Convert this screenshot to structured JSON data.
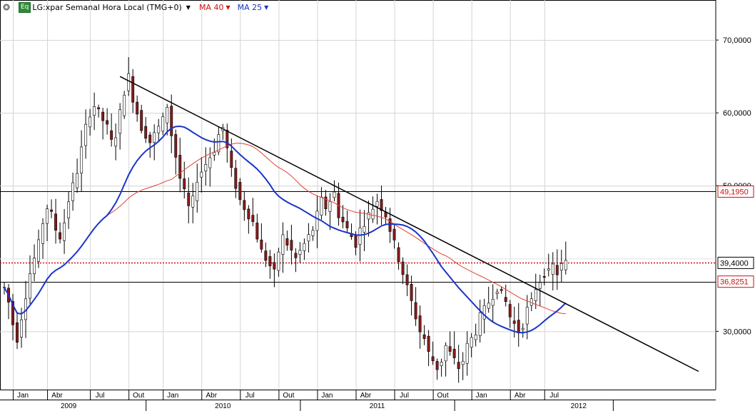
{
  "header": {
    "badge": "Eq",
    "instrument": "LG:xpar Semanal Hora Local (TMG+0)",
    "ma40_label": "MA 40",
    "ma25_label": "MA 25"
  },
  "colors": {
    "ma40": "#e0403a",
    "ma25": "#1a35c8",
    "up_candle": "#ffffff",
    "down_candle": "#8b1a1a",
    "label_red": "#cc1111"
  },
  "chart_data": {
    "type": "candlestick",
    "price_axis": {
      "ticks": [
        "70,0000",
        "60,0000",
        "50,0000",
        "30,0000"
      ],
      "tick_values": [
        70,
        60,
        50,
        30
      ],
      "range": [
        22.0,
        75.5
      ]
    },
    "price_labels": [
      {
        "text": "49,1950",
        "value": 49.195,
        "style": "boxed-red"
      },
      {
        "text": "39,4000",
        "value": 39.4,
        "style": "boxed-black"
      },
      {
        "text": "36,8251",
        "value": 36.8251,
        "style": "boxed-red"
      }
    ],
    "horizontal_levels": [
      {
        "value": 49.195,
        "style": "solid"
      },
      {
        "value": 39.4,
        "style": "dotted-red"
      },
      {
        "value": 36.8251,
        "style": "solid"
      }
    ],
    "trendline": {
      "start": {
        "week": 28,
        "value": 65.0
      },
      "end": {
        "week": 163,
        "value": 24.5
      }
    },
    "x_axis": {
      "week_range": [
        0,
        167
      ],
      "month_labels": [
        "Jan",
        "Abr",
        "Jul",
        "Out",
        "Jan",
        "Abr",
        "Jul",
        "Out",
        "Jan",
        "Abr",
        "Jul",
        "Out",
        "Jan",
        "Abr",
        "Jul"
      ],
      "month_weeks": [
        3,
        11,
        21,
        30,
        38,
        47,
        56,
        65,
        74,
        83,
        92,
        101,
        110,
        119,
        127
      ],
      "years": [
        "2009",
        "2010",
        "2011",
        "2012"
      ],
      "year_weeks": [
        16,
        52,
        88,
        135
      ],
      "year_boundaries": [
        34,
        70,
        106,
        143
      ]
    },
    "weekly_closes": [
      36,
      34,
      31,
      29,
      32,
      35,
      38,
      40,
      42,
      45,
      47,
      46,
      44,
      43,
      45,
      48,
      50,
      52,
      55,
      58,
      60,
      61,
      60,
      59,
      58,
      56,
      57,
      60,
      63,
      65,
      62,
      60,
      58,
      57,
      56,
      57,
      58,
      59,
      61,
      57,
      54,
      51,
      49,
      47,
      48,
      51,
      52,
      53,
      54,
      55,
      57,
      58,
      55,
      52,
      50,
      48,
      47,
      46,
      45,
      43,
      41,
      40,
      39,
      38,
      41,
      43,
      42,
      41,
      40,
      41,
      42,
      43,
      44,
      46,
      48,
      47,
      48,
      49,
      46,
      45,
      44,
      43,
      42,
      44,
      45,
      46,
      47,
      48,
      47,
      46,
      44,
      42,
      40,
      38,
      36,
      34,
      32,
      30,
      29,
      27,
      26,
      25,
      26,
      28,
      27,
      26,
      25,
      26,
      28,
      29,
      30,
      32,
      33,
      34,
      35,
      36,
      35,
      34,
      32,
      31,
      30,
      31,
      33,
      34,
      36,
      37,
      38,
      38,
      39,
      38,
      39,
      39.4
    ]
  }
}
